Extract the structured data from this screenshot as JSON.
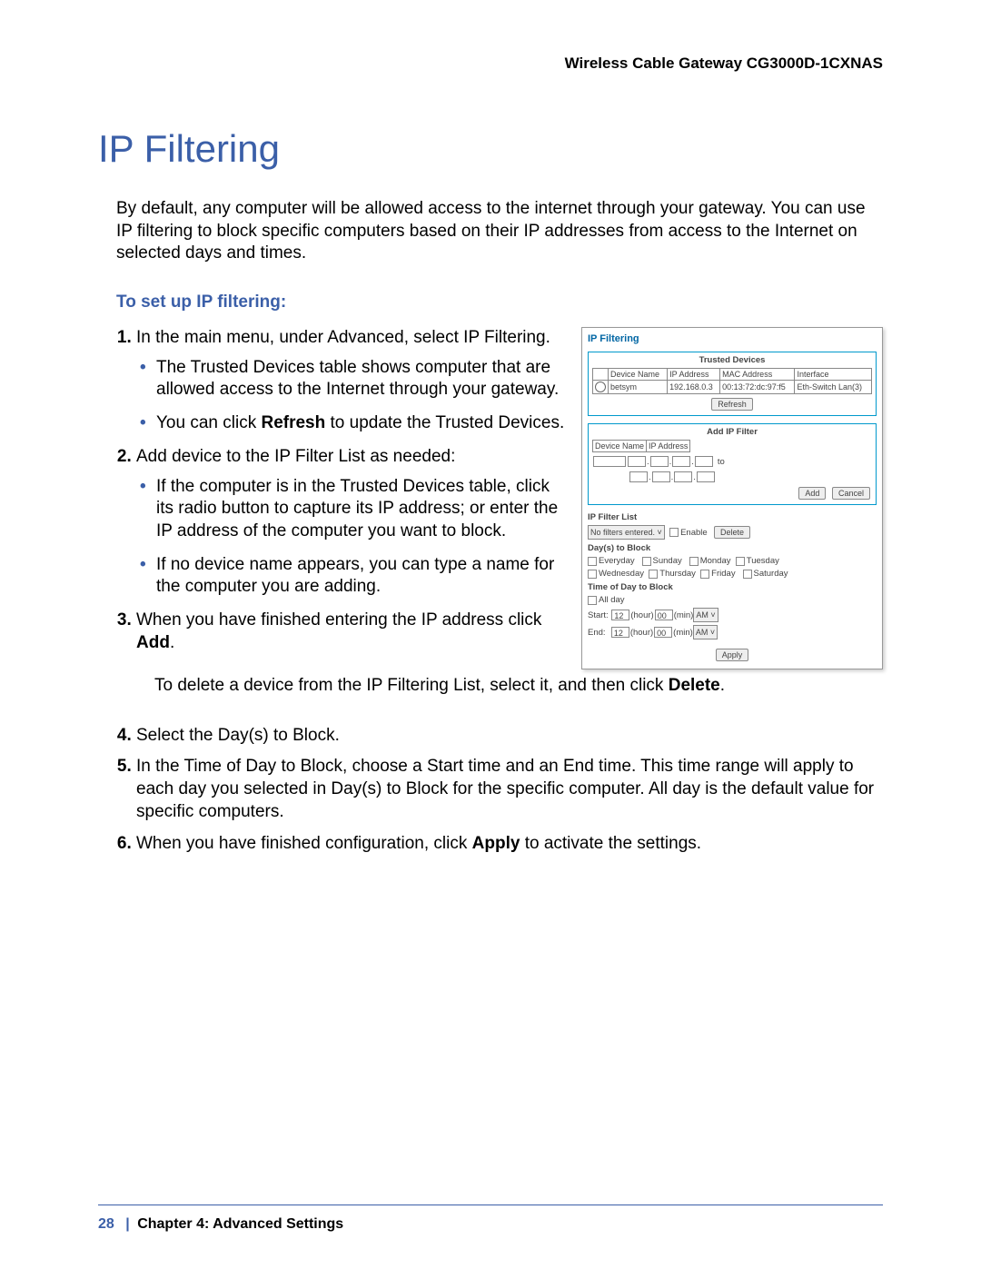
{
  "header": {
    "product": "Wireless Cable Gateway CG3000D-1CXNAS"
  },
  "title": "IP Filtering",
  "intro": "By default, any computer will be allowed access to the internet through your gateway. You can use IP filtering to block specific computers based on their IP addresses from access to the Internet on selected days and times.",
  "subheading": "To set up IP filtering:",
  "steps": {
    "s1": "In the main menu, under Advanced, select IP Filtering.",
    "s1b1": "The Trusted Devices table shows computer that are allowed access to the Internet through your gateway.",
    "s1b2a": "You can click ",
    "s1b2bold": "Refresh",
    "s1b2c": " to update the Trusted Devices.",
    "s2": "Add device to the IP Filter List as needed:",
    "s2b1": "If the computer is in the Trusted Devices table, click its radio button to capture its IP address; or enter the IP address of the computer you want to block.",
    "s2b2": "If no device name appears, you can type a name for the computer you are adding.",
    "s3a": "When you have finished entering the IP address click ",
    "s3bold": "Add",
    "s3c": ".",
    "s3note_a": "To delete a device from the IP Filtering List, select it, and then click ",
    "s3note_bold": "Delete",
    "s3note_c": ".",
    "s4": "Select the Day(s) to Block.",
    "s5": "In the Time of Day to Block, choose a Start time and an End time. This time range will apply to each day you selected in Day(s) to Block for the specific computer. All day is the default value for specific computers.",
    "s6a": "When you have finished configuration, click ",
    "s6bold": "Apply",
    "s6c": " to activate the settings."
  },
  "shot": {
    "title": "IP Filtering",
    "trusted_title": "Trusted Devices",
    "th_device": "Device Name",
    "th_ip": "IP Address",
    "th_mac": "MAC Address",
    "th_if": "Interface",
    "row_device": "betsym",
    "row_ip": "192.168.0.3",
    "row_mac": "00:13:72:dc:97:f5",
    "row_if": "Eth-Switch Lan(3)",
    "refresh": "Refresh",
    "addfilter_title": "Add IP Filter",
    "lbl_device": "Device Name",
    "lbl_ip": "IP Address",
    "to": "to",
    "add": "Add",
    "cancel": "Cancel",
    "list_title": "IP Filter List",
    "no_filters": "No filters entered.",
    "enable": "Enable",
    "delete": "Delete",
    "days_title": "Day(s) to Block",
    "d_every": "Everyday",
    "d_sun": "Sunday",
    "d_mon": "Monday",
    "d_tue": "Tuesday",
    "d_wed": "Wednesday",
    "d_thu": "Thursday",
    "d_fri": "Friday",
    "d_sat": "Saturday",
    "time_title": "Time of Day to Block",
    "allday": "All day",
    "start": "Start:",
    "end": "End:",
    "hour": "(hour)",
    "min": "(min)",
    "h12": "12",
    "m00": "00",
    "ampm": "AM",
    "apply": "Apply"
  },
  "footer": {
    "page": "28",
    "sep": "|",
    "chapter": "Chapter 4:  Advanced Settings"
  }
}
